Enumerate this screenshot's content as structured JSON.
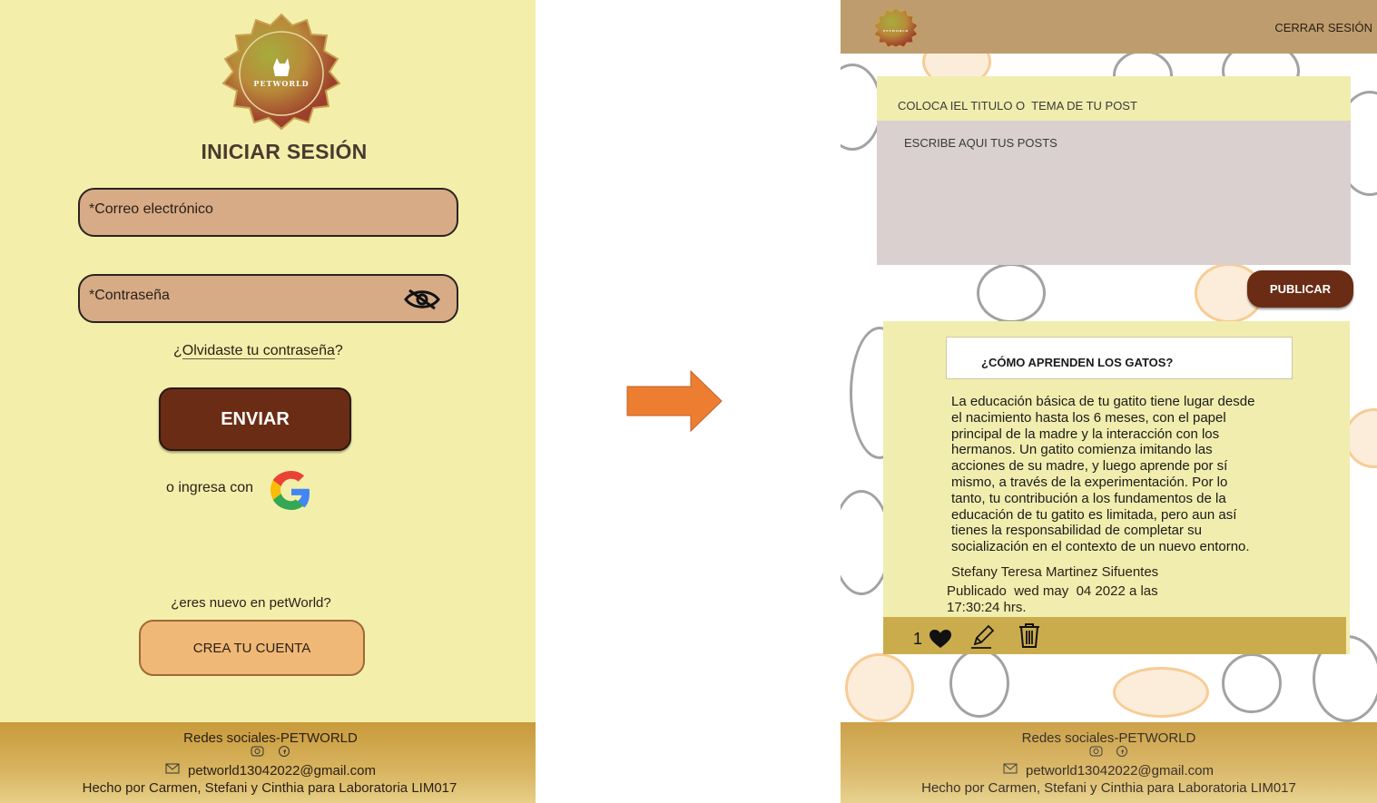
{
  "login": {
    "logo_text": "PETWORLD",
    "title": "INICIAR SESIÓN",
    "email_placeholder": "*Correo electrónico",
    "password_placeholder": "*Contraseña",
    "forgot_prefix": "¿",
    "forgot_link": "Olvidaste tu contraseña",
    "forgot_suffix": "?",
    "submit_label": "ENVIAR",
    "alt_login_label": "o ingresa con",
    "new_user_text": "¿eres nuevo en petWorld?",
    "create_account_label": "CREA TU CUENTA"
  },
  "footer": {
    "social_title": "Redes sociales-PETWORLD",
    "email": "petworld13042022@gmail.com",
    "credits": "Hecho por Carmen, Stefani y Cinthia para Laboratoria LIM017"
  },
  "feed": {
    "logo_text": "PETWORLD",
    "logout_label": "CERRAR SESIÓN",
    "title_input_placeholder": "COLOCA IEL TITULO O  TEMA DE TU POST",
    "post_input_placeholder": "ESCRIBE AQUI TUS POSTS",
    "publish_label": "PUBLICAR",
    "post": {
      "title": "¿CÓMO APRENDEN LOS GATOS?",
      "body_lines": [
        "La educación básica de tu gatito tiene lugar desde",
        "el nacimiento hasta los 6 meses, con el papel",
        "principal de la madre y la interacción con los",
        "hermanos. Un gatito comienza imitando las",
        "acciones de su madre, y luego aprende por sí",
        "mismo, a través de la experimentación. Por lo",
        "tanto, tu contribución a los fundamentos de la",
        "educación de tu gatito es limitada, pero aun así",
        "tienes la responsabilidad de completar su",
        "socialización en el contexto de un nuevo entorno."
      ],
      "author": "Stefany Teresa Martinez Sifuentes",
      "published_line1": "Publicado  wed may  04 2022 a las",
      "published_line2": "17:30:24 hrs.",
      "likes": "1"
    }
  },
  "icons": {
    "eye_slash": "eye-slash-icon",
    "google": "google-icon",
    "arrow": "arrow-right-icon",
    "instagram": "instagram-icon",
    "facebook": "facebook-icon",
    "mail": "mail-icon",
    "heart": "heart-icon",
    "edit": "edit-icon",
    "trash": "trash-icon"
  },
  "colors": {
    "panel_bg": "#f3efab",
    "field_bg": "#d6ab86",
    "primary_button": "#6a2c14",
    "secondary_button": "#f0b877",
    "arrow": "#ed7d31",
    "topbar": "#bf9c6d",
    "footer": "#c89a3a"
  }
}
